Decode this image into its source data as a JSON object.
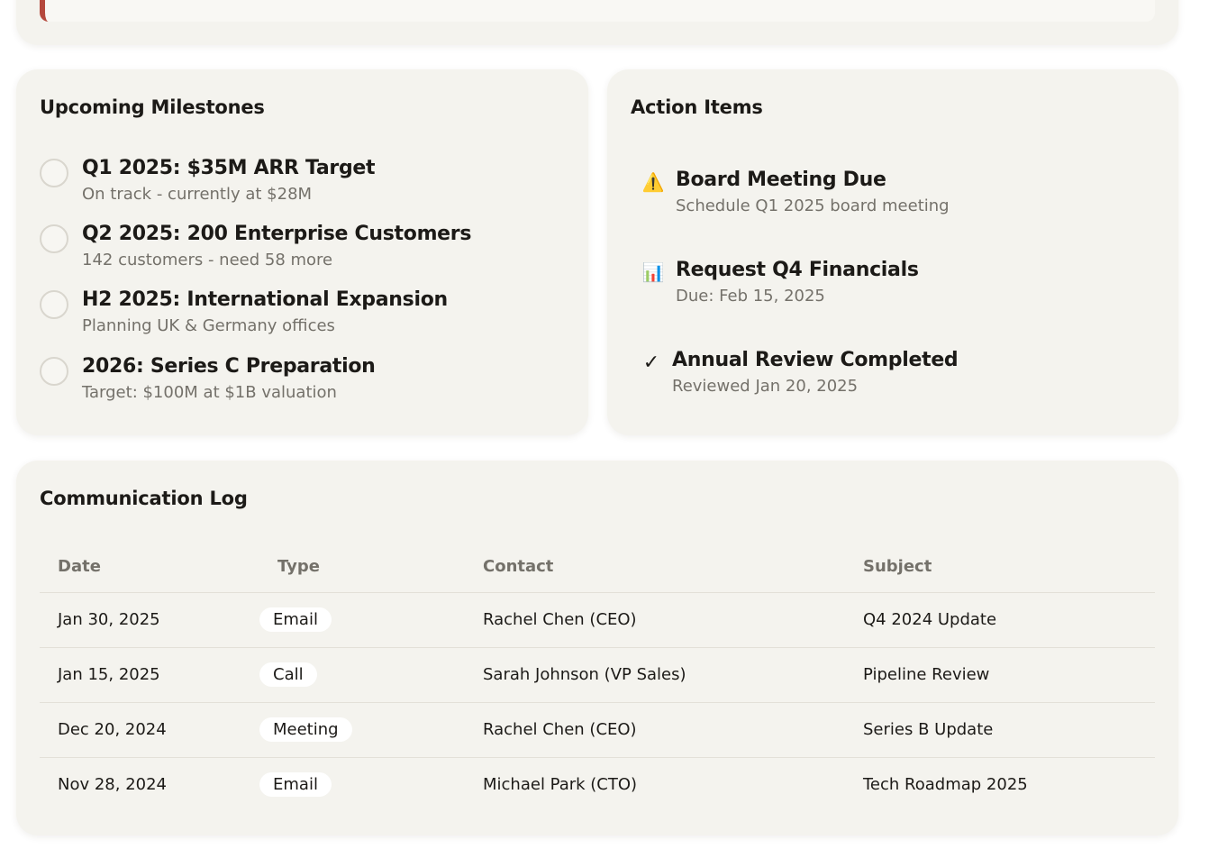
{
  "milestones": {
    "title": "Upcoming Milestones",
    "items": [
      {
        "title": "Q1 2025: $35M ARR Target",
        "subtitle": "On track - currently at $28M"
      },
      {
        "title": "Q2 2025: 200 Enterprise Customers",
        "subtitle": "142 customers - need 58 more"
      },
      {
        "title": "H2 2025: International Expansion",
        "subtitle": "Planning UK & Germany offices"
      },
      {
        "title": "2026: Series C Preparation",
        "subtitle": "Target: $100M at $1B valuation"
      }
    ]
  },
  "actions": {
    "title": "Action Items",
    "items": [
      {
        "icon": "⚠️",
        "icon_name": "warning-icon",
        "title": "Board Meeting Due",
        "subtitle": "Schedule Q1 2025 board meeting"
      },
      {
        "icon": "📊",
        "icon_name": "bar-chart-icon",
        "title": "Request Q4 Financials",
        "subtitle": "Due: Feb 15, 2025"
      },
      {
        "icon": "✓",
        "icon_name": "checkmark-icon",
        "title": "Annual Review Completed",
        "subtitle": "Reviewed Jan 20, 2025"
      }
    ]
  },
  "comms": {
    "title": "Communication Log",
    "columns": [
      "Date",
      "Type",
      "Contact",
      "Subject"
    ],
    "rows": [
      {
        "date": "Jan 30, 2025",
        "type": "Email",
        "contact": "Rachel Chen (CEO)",
        "subject": "Q4 2024 Update"
      },
      {
        "date": "Jan 15, 2025",
        "type": "Call",
        "contact": "Sarah Johnson (VP Sales)",
        "subject": "Pipeline Review"
      },
      {
        "date": "Dec 20, 2024",
        "type": "Meeting",
        "contact": "Rachel Chen (CEO)",
        "subject": "Series B Update"
      },
      {
        "date": "Nov 28, 2024",
        "type": "Email",
        "contact": "Michael Park (CTO)",
        "subject": "Tech Roadmap 2025"
      }
    ]
  },
  "colors": {
    "card_bg": "#f4f3ee",
    "alert_accent": "#b5483c",
    "muted_text": "#74716a"
  }
}
